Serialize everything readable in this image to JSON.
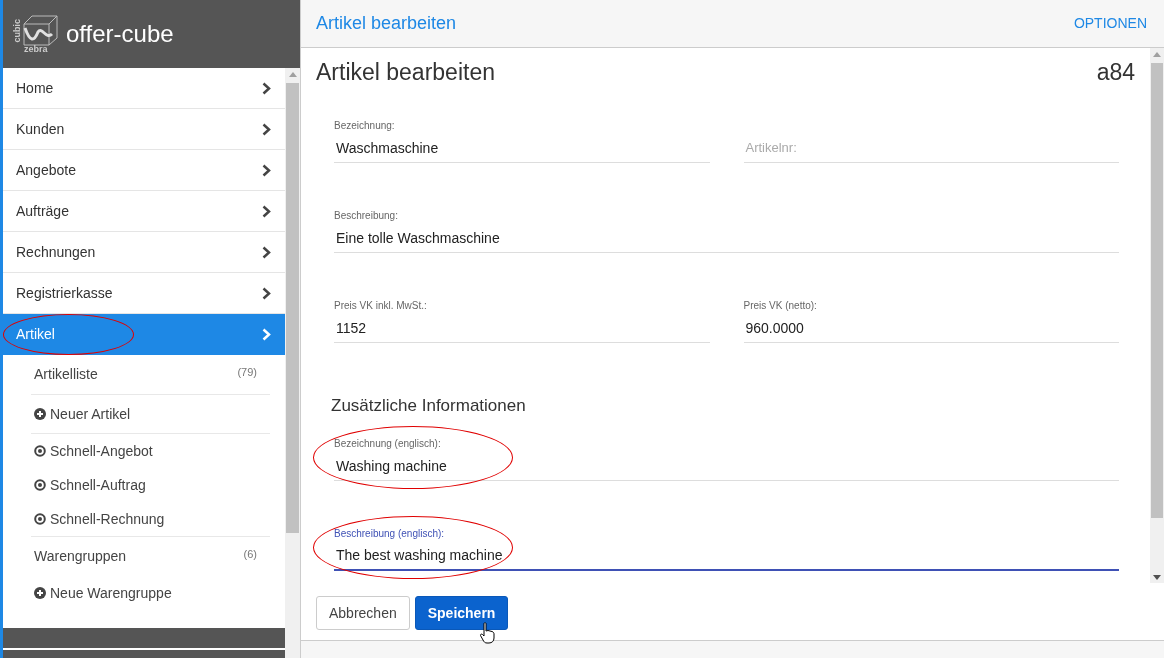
{
  "app": {
    "name": "offer-cube",
    "logo_words": [
      "cubic",
      "zebra"
    ]
  },
  "nav": [
    {
      "label": "Home",
      "selected": false,
      "circled": false
    },
    {
      "label": "Kunden",
      "selected": false,
      "circled": false
    },
    {
      "label": "Angebote",
      "selected": false,
      "circled": false
    },
    {
      "label": "Aufträge",
      "selected": false,
      "circled": false
    },
    {
      "label": "Rechnungen",
      "selected": false,
      "circled": false
    },
    {
      "label": "Registrierkasse",
      "selected": false,
      "circled": false
    },
    {
      "label": "Artikel",
      "selected": true,
      "circled": true
    }
  ],
  "submenu_groups": [
    [
      {
        "kind": "list",
        "label": "Artikelliste",
        "count": "(79)"
      }
    ],
    [
      {
        "kind": "add",
        "label": "Neuer Artikel"
      }
    ],
    [
      {
        "kind": "quick",
        "label": "Schnell-Angebot"
      },
      {
        "kind": "quick",
        "label": "Schnell-Auftrag"
      },
      {
        "kind": "quick",
        "label": "Schnell-Rechnung"
      }
    ],
    [
      {
        "kind": "list",
        "label": "Warengruppen",
        "count": "(6)"
      },
      {
        "kind": "add",
        "label": "Neue Warengruppe"
      }
    ]
  ],
  "topbar": {
    "title": "Artikel bearbeiten",
    "options": "OPTIONEN"
  },
  "form": {
    "title": "Artikel bearbeiten",
    "id": "a84",
    "rows": [
      [
        {
          "label": "Bezeichnung:",
          "value": "Waschmaschine",
          "focused": false,
          "circled": false
        },
        {
          "placeholder": "Artikelnr:",
          "focused": false,
          "circled": false
        }
      ],
      [
        {
          "label": "Beschreibung:",
          "value": "Eine tolle Waschmaschine",
          "focused": false,
          "circled": false
        }
      ],
      [
        {
          "label": "Preis VK inkl. MwSt.:",
          "value": "1152",
          "focused": false,
          "circled": false
        },
        {
          "label": "Preis VK (netto):",
          "value": "960.0000",
          "focused": false,
          "circled": false
        }
      ],
      {
        "section": "Zusätzliche Informationen"
      },
      [
        {
          "label": "Bezeichnung (englisch):",
          "value": "Washing machine",
          "focused": false,
          "circled": true
        }
      ],
      [
        {
          "label": "Beschreibung (englisch):",
          "value": "The best washing machine",
          "focused": true,
          "circled": true
        }
      ]
    ]
  },
  "buttons": [
    {
      "label": "Abbrechen",
      "kind": "secondary"
    },
    {
      "label": "Speichern",
      "kind": "primary"
    }
  ]
}
